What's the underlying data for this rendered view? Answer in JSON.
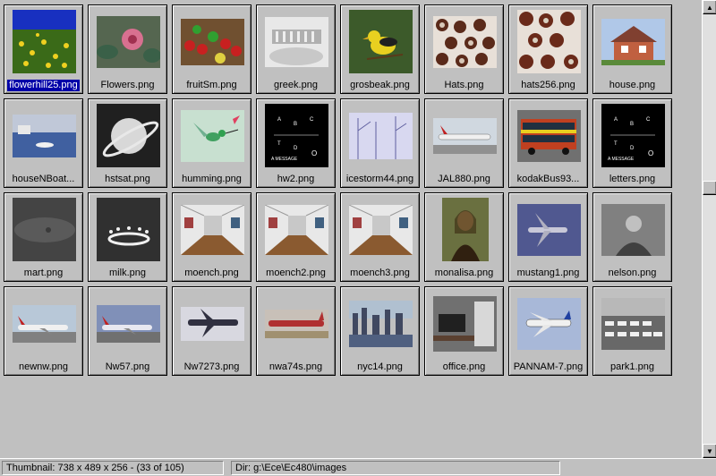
{
  "thumbnails": [
    [
      {
        "name": "flowerhill25.png",
        "selected": true
      },
      {
        "name": "Flowers.png"
      },
      {
        "name": "fruitSm.png"
      },
      {
        "name": "greek.png"
      },
      {
        "name": "grosbeak.png"
      },
      {
        "name": "Hats.png"
      },
      {
        "name": "hats256.png"
      },
      {
        "name": "house.png"
      }
    ],
    [
      {
        "name": "houseNBoat..."
      },
      {
        "name": "hstsat.png"
      },
      {
        "name": "humming.png"
      },
      {
        "name": "hw2.png"
      },
      {
        "name": "icestorm44.png"
      },
      {
        "name": "JAL880.png"
      },
      {
        "name": "kodakBus93..."
      },
      {
        "name": "letters.png"
      }
    ],
    [
      {
        "name": "mart.png"
      },
      {
        "name": "milk.png"
      },
      {
        "name": "moench.png"
      },
      {
        "name": "moench2.png"
      },
      {
        "name": "moench3.png"
      },
      {
        "name": "monalisa.png"
      },
      {
        "name": "mustang1.png"
      },
      {
        "name": "nelson.png"
      }
    ],
    [
      {
        "name": "newnw.png"
      },
      {
        "name": "Nw57.png"
      },
      {
        "name": "Nw7273.png"
      },
      {
        "name": "nwa74s.png"
      },
      {
        "name": "nyc14.png"
      },
      {
        "name": "office.png"
      },
      {
        "name": "PANNAM-7.png"
      },
      {
        "name": "park1.png"
      }
    ]
  ],
  "letters_image": {
    "a": "A",
    "b": "B",
    "c": "C",
    "t": "T",
    "d": "D",
    "o": "O",
    "msg": "A MESSAGE"
  },
  "status": {
    "thumbnail": "Thumbnail: 738 x 489 x 256 - (33 of 105)",
    "dir": "Dir: g:\\Ece\\Ec480\\images"
  },
  "scrollbar": {
    "up_icon": "arrow-up-icon",
    "down_icon": "arrow-down-icon",
    "position_fraction": 0.4
  },
  "colors": {
    "selection": "#0000ff",
    "face": "#c0c0c0"
  }
}
